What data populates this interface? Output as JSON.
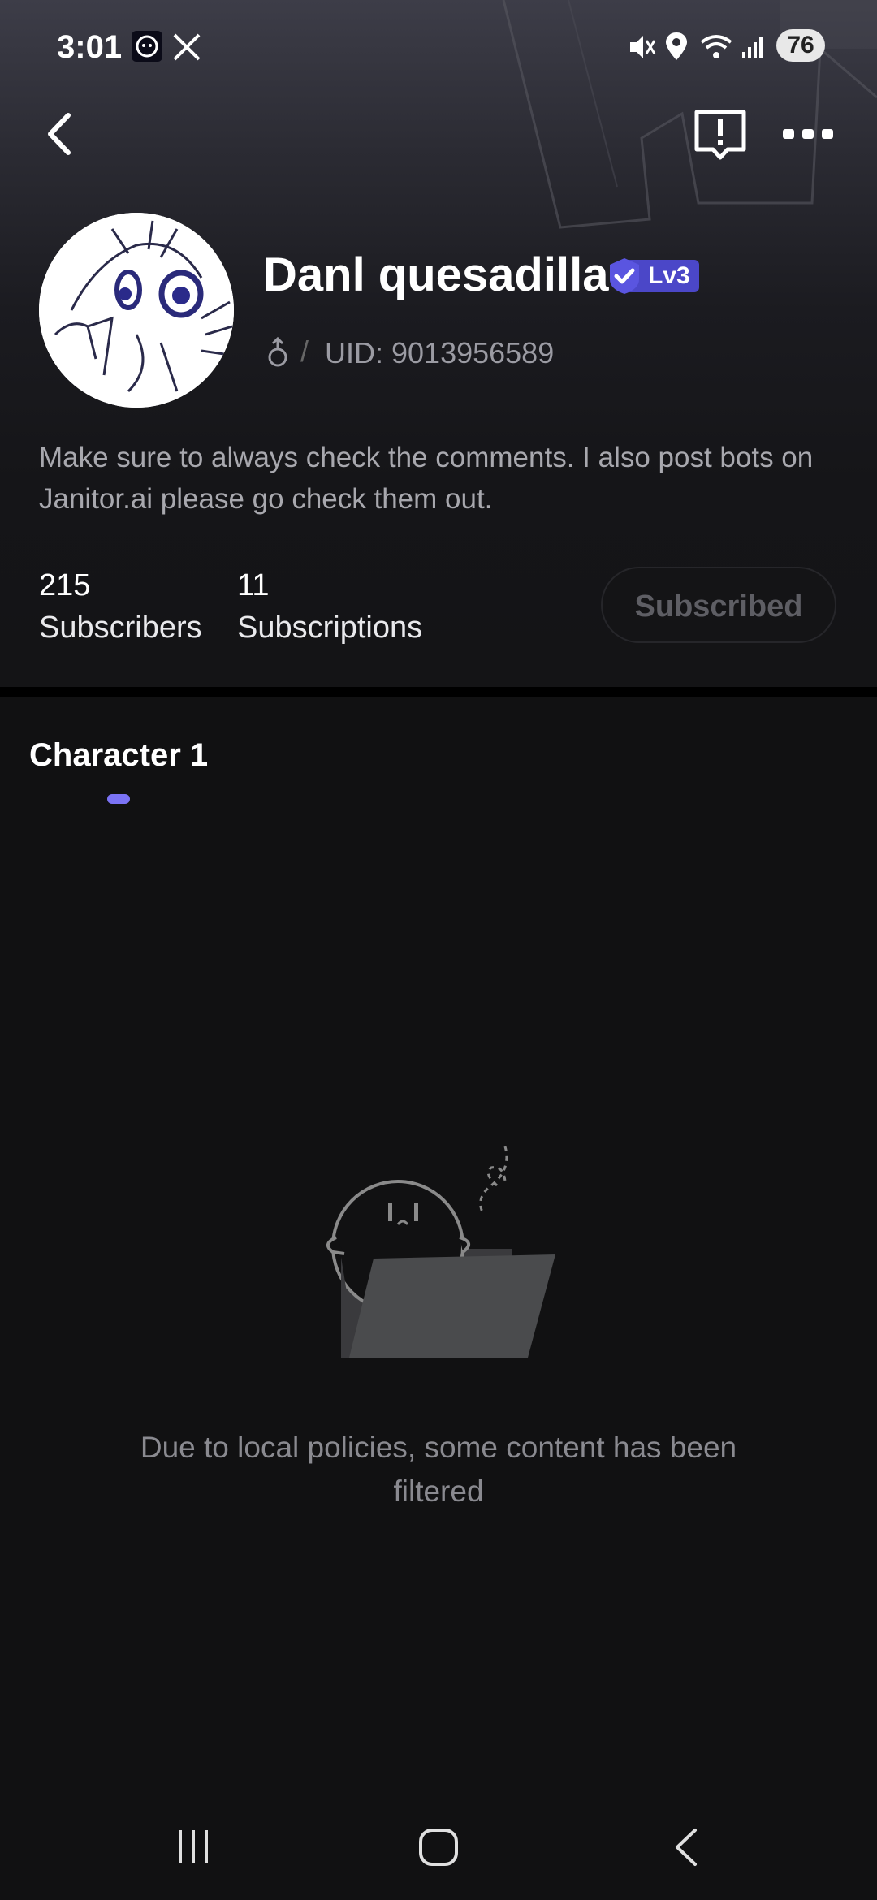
{
  "status_bar": {
    "time": "3:01",
    "battery": "76",
    "icons": [
      "app-icon",
      "x-icon",
      "mute-icon",
      "location-icon",
      "wifi-icon",
      "signal-icon"
    ]
  },
  "profile": {
    "username": "Danl quesadilla",
    "level": "Lv3",
    "uid": "UID: 9013956589",
    "bio": "Make sure to always check the comments. I also post bots on Janitor.ai please go check them out.",
    "subscribers_count": "215",
    "subscribers_label": "Subscribers",
    "subscriptions_count": "11",
    "subscriptions_label": "Subscriptions",
    "subscribed_button": "Subscribed"
  },
  "tabs": [
    {
      "label": "Character 1",
      "active": true
    }
  ],
  "empty_state": {
    "message": "Due to local policies, some content has been filtered"
  },
  "colors": {
    "accent": "#7b73f5",
    "verify_badge": "#4b47c8",
    "background": "#111112"
  }
}
